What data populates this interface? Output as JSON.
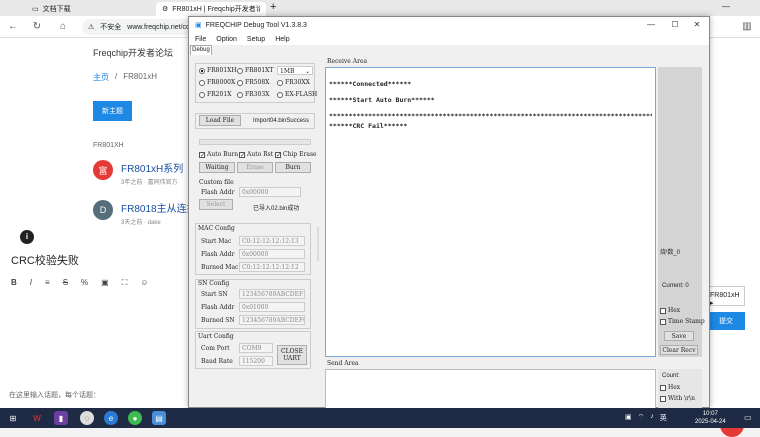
{
  "browser": {
    "tabs": [
      {
        "label": "文档下载"
      },
      {
        "label": "FR801xH | Freqchip开发者论坛"
      }
    ],
    "insecure_label": "不安全",
    "url": "www.freqchip.net/co"
  },
  "forum": {
    "title": "Freqchip开发者论坛",
    "crumb_home": "主页",
    "crumb_current": "FR801xH",
    "new_topic": "新主题",
    "category": "FR801XH",
    "topics": [
      {
        "avatar": "富",
        "title": "FR801xH系列",
        "meta": "3年之前 · 富同伟官方",
        "color": "#e53935"
      },
      {
        "avatar": "D",
        "title": "FR8018主从连接",
        "meta": "3天之前 · dake",
        "color": "#546e7a"
      }
    ],
    "editor_title": "CRC校验失败",
    "editor_tools": [
      "B",
      "I",
      "≡",
      "S",
      "%",
      "▣",
      "⛶",
      "☺"
    ],
    "tags_placeholder": "在这里输入话题，每个话题：",
    "right_select": "FR801xH ▸",
    "submit": "提交"
  },
  "app": {
    "title": "FREQCHIP Debug Tool V1.3.8.3",
    "menu": [
      "File",
      "Option",
      "Setup",
      "Help"
    ],
    "tab": "Debug",
    "chips": [
      {
        "label": "FR801XH",
        "selected": true
      },
      {
        "label": "FR801XT",
        "selected": false
      },
      {
        "label": "FR8000X",
        "selected": false
      },
      {
        "label": "FR508X",
        "selected": false
      },
      {
        "label": "FR30XX",
        "selected": false
      },
      {
        "label": "FR201X",
        "selected": false
      },
      {
        "label": "FR303X",
        "selected": false
      },
      {
        "label": "EX-FLASH",
        "selected": false
      }
    ],
    "size_select": "1MB",
    "load_file": "Load File",
    "load_status": "Import04.binSuccess",
    "auto_burn": "Auto Burn",
    "auto_rst": "Auto Rst",
    "chip_erase": "Chip Erase",
    "waiting": "Waiting",
    "erase": "Erase",
    "burn": "Burn",
    "custom_file": "Custom file",
    "flash_addr_label": "Flash Addr",
    "flash_addr_value": "0x00000",
    "select": "Select",
    "import_msg": "已导入02.bin成功",
    "mac_config": "MAC Config",
    "start_mac_label": "Start Mac",
    "start_mac_value": "C0:12:12:12:12:13",
    "mac_flash_addr_value": "0x00000",
    "burned_mac_label": "Burned Mac",
    "burned_mac_value": "C0:12:12:12:12:12",
    "sn_config": "SN Config",
    "start_sn_label": "Start SN",
    "start_sn_value": "123456789ABCDEF1",
    "sn_flash_addr_value": "0x01000",
    "burned_sn_label": "Burned SN",
    "burned_sn_value": "123456789ABCDEF0",
    "uart_config": "Uart Config",
    "com_port_label": "Com Port",
    "com_port_value": "COM9",
    "baud_label": "Baud Rate",
    "baud_value": "115200",
    "close_uart": "CLOSE UART",
    "receive_area": "Receive Area",
    "send_area": "Send Area",
    "recv_lines": [
      "******Connected******",
      "******Start Auto Burn******",
      "****************************************************************************************************",
      "******CRC Fail******"
    ],
    "burn_count": "烧ᵗ数_0",
    "current_label": "Current: 0",
    "hex": "Hex",
    "time_stamp": "Time Stamp",
    "save": "Save",
    "clear_recv": "Clear Recv",
    "count_label": "Count:",
    "send_hex": "Hex",
    "with_rn": "With \\r\\n"
  },
  "taskbar": {
    "time": "10:07",
    "date": "2025-04-24",
    "lang": "英"
  }
}
